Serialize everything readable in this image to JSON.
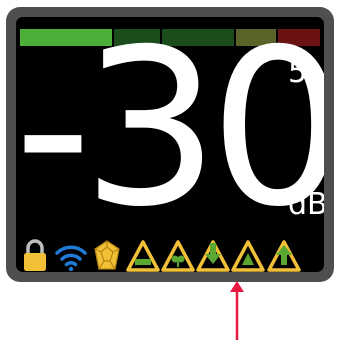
{
  "meter": {
    "value": "-30",
    "decimal": "5",
    "unit": "dB"
  },
  "level_bar": {
    "segments": [
      {
        "color": "#4caf37",
        "weight": 95
      },
      {
        "color": "#1b4d1c",
        "weight": 47
      },
      {
        "color": "#1b4d1c",
        "weight": 74
      },
      {
        "color": "#5b6328",
        "weight": 41
      },
      {
        "color": "#6b1212",
        "weight": 43
      }
    ]
  },
  "status_icons": [
    {
      "name": "lock-icon",
      "color": "#f2c037"
    },
    {
      "name": "wifi-icon",
      "color": "#1e7bd6"
    },
    {
      "name": "gem-icon",
      "color": "#f2c037"
    },
    {
      "name": "triangle-bar-icon",
      "color": "#f2c037"
    },
    {
      "name": "triangle-tree-icon",
      "color": "#f2c037"
    },
    {
      "name": "triangle-down-arrow-icon",
      "color": "#f2c037"
    },
    {
      "name": "triangle-outline-icon",
      "color": "#f2c037"
    },
    {
      "name": "triangle-up-arrow-icon",
      "color": "#f2c037"
    }
  ],
  "colors": {
    "accent_green": "#6cc04a",
    "annotation_arrow": "#e8193f",
    "bezel": "#4f4f4f"
  }
}
